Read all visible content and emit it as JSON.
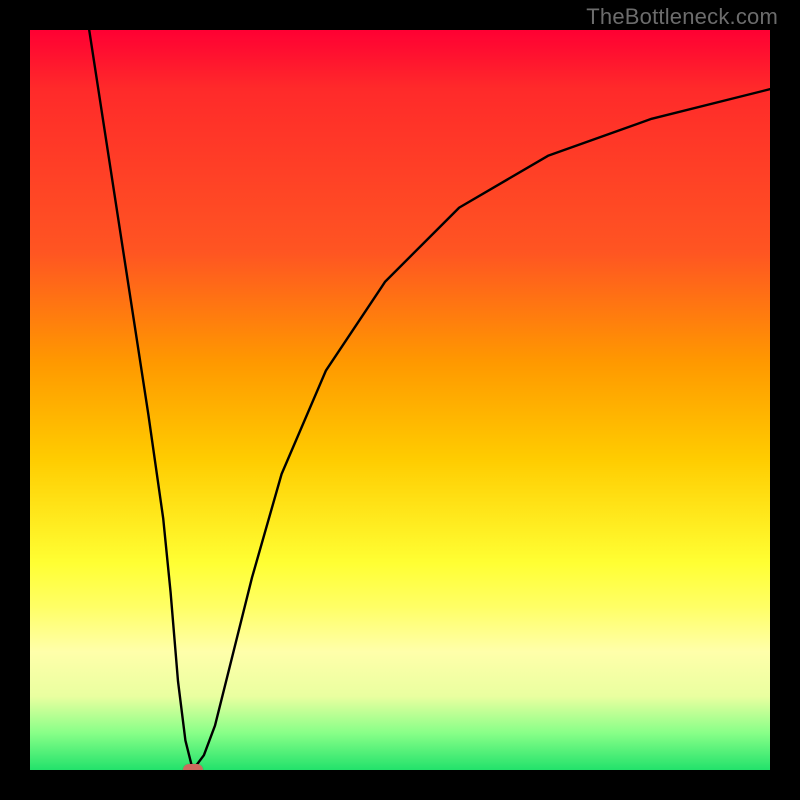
{
  "watermark": "TheBottleneck.com",
  "chart_data": {
    "type": "line",
    "title": "",
    "xlabel": "",
    "ylabel": "",
    "xlim": [
      0,
      100
    ],
    "ylim": [
      0,
      100
    ],
    "background_gradient": {
      "top": "#ff0033",
      "mid_upper": "#ff9900",
      "mid": "#ffff33",
      "mid_lower": "#eaffa0",
      "bottom": "#22e26b"
    },
    "series": [
      {
        "name": "bottleneck-curve",
        "color": "#000000",
        "x": [
          8,
          10,
          12,
          14,
          16,
          18,
          19,
          20,
          21,
          22,
          23.5,
          25,
          27,
          30,
          34,
          40,
          48,
          58,
          70,
          84,
          100
        ],
        "y": [
          100,
          87,
          74,
          61,
          48,
          34,
          24,
          12,
          4,
          0,
          2,
          6,
          14,
          26,
          40,
          54,
          66,
          76,
          83,
          88,
          92
        ]
      }
    ],
    "highlight_marker": {
      "x": 22,
      "y": 0,
      "color": "#cc6b5e",
      "shape": "rounded-rect"
    },
    "grid": false,
    "legend": false
  }
}
